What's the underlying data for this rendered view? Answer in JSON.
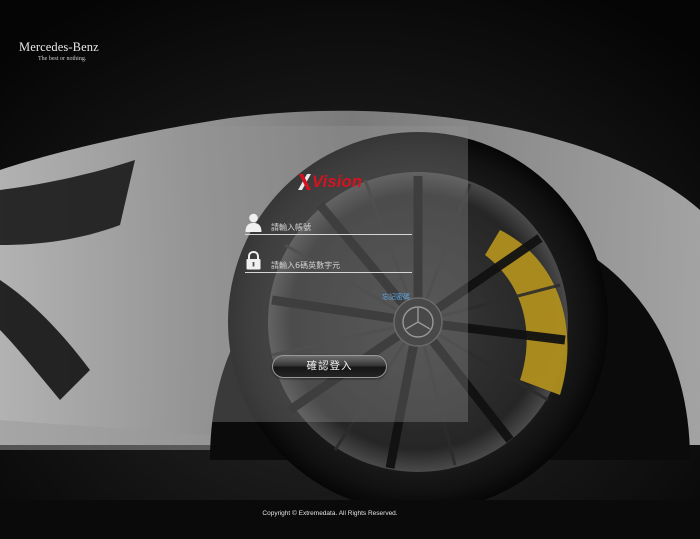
{
  "brand": {
    "name": "Mercedes-Benz",
    "tagline": "The best or nothing."
  },
  "logo": {
    "text": "Vision",
    "color": "#d8111f"
  },
  "form": {
    "account_placeholder": "請輸入帳號",
    "password_placeholder": "請輸入6碼英數字元",
    "forgot_password": "忘記密碼",
    "login_button": "確認登入"
  },
  "icons": {
    "account": "user-icon",
    "password": "lock-icon"
  },
  "footer": {
    "copyright": "Copyright © Extremedata. All Rights Reserved."
  },
  "colors": {
    "accent_red": "#d8111f",
    "link_blue": "#5fa8e4",
    "brake_caliper": "#b08f1e"
  }
}
